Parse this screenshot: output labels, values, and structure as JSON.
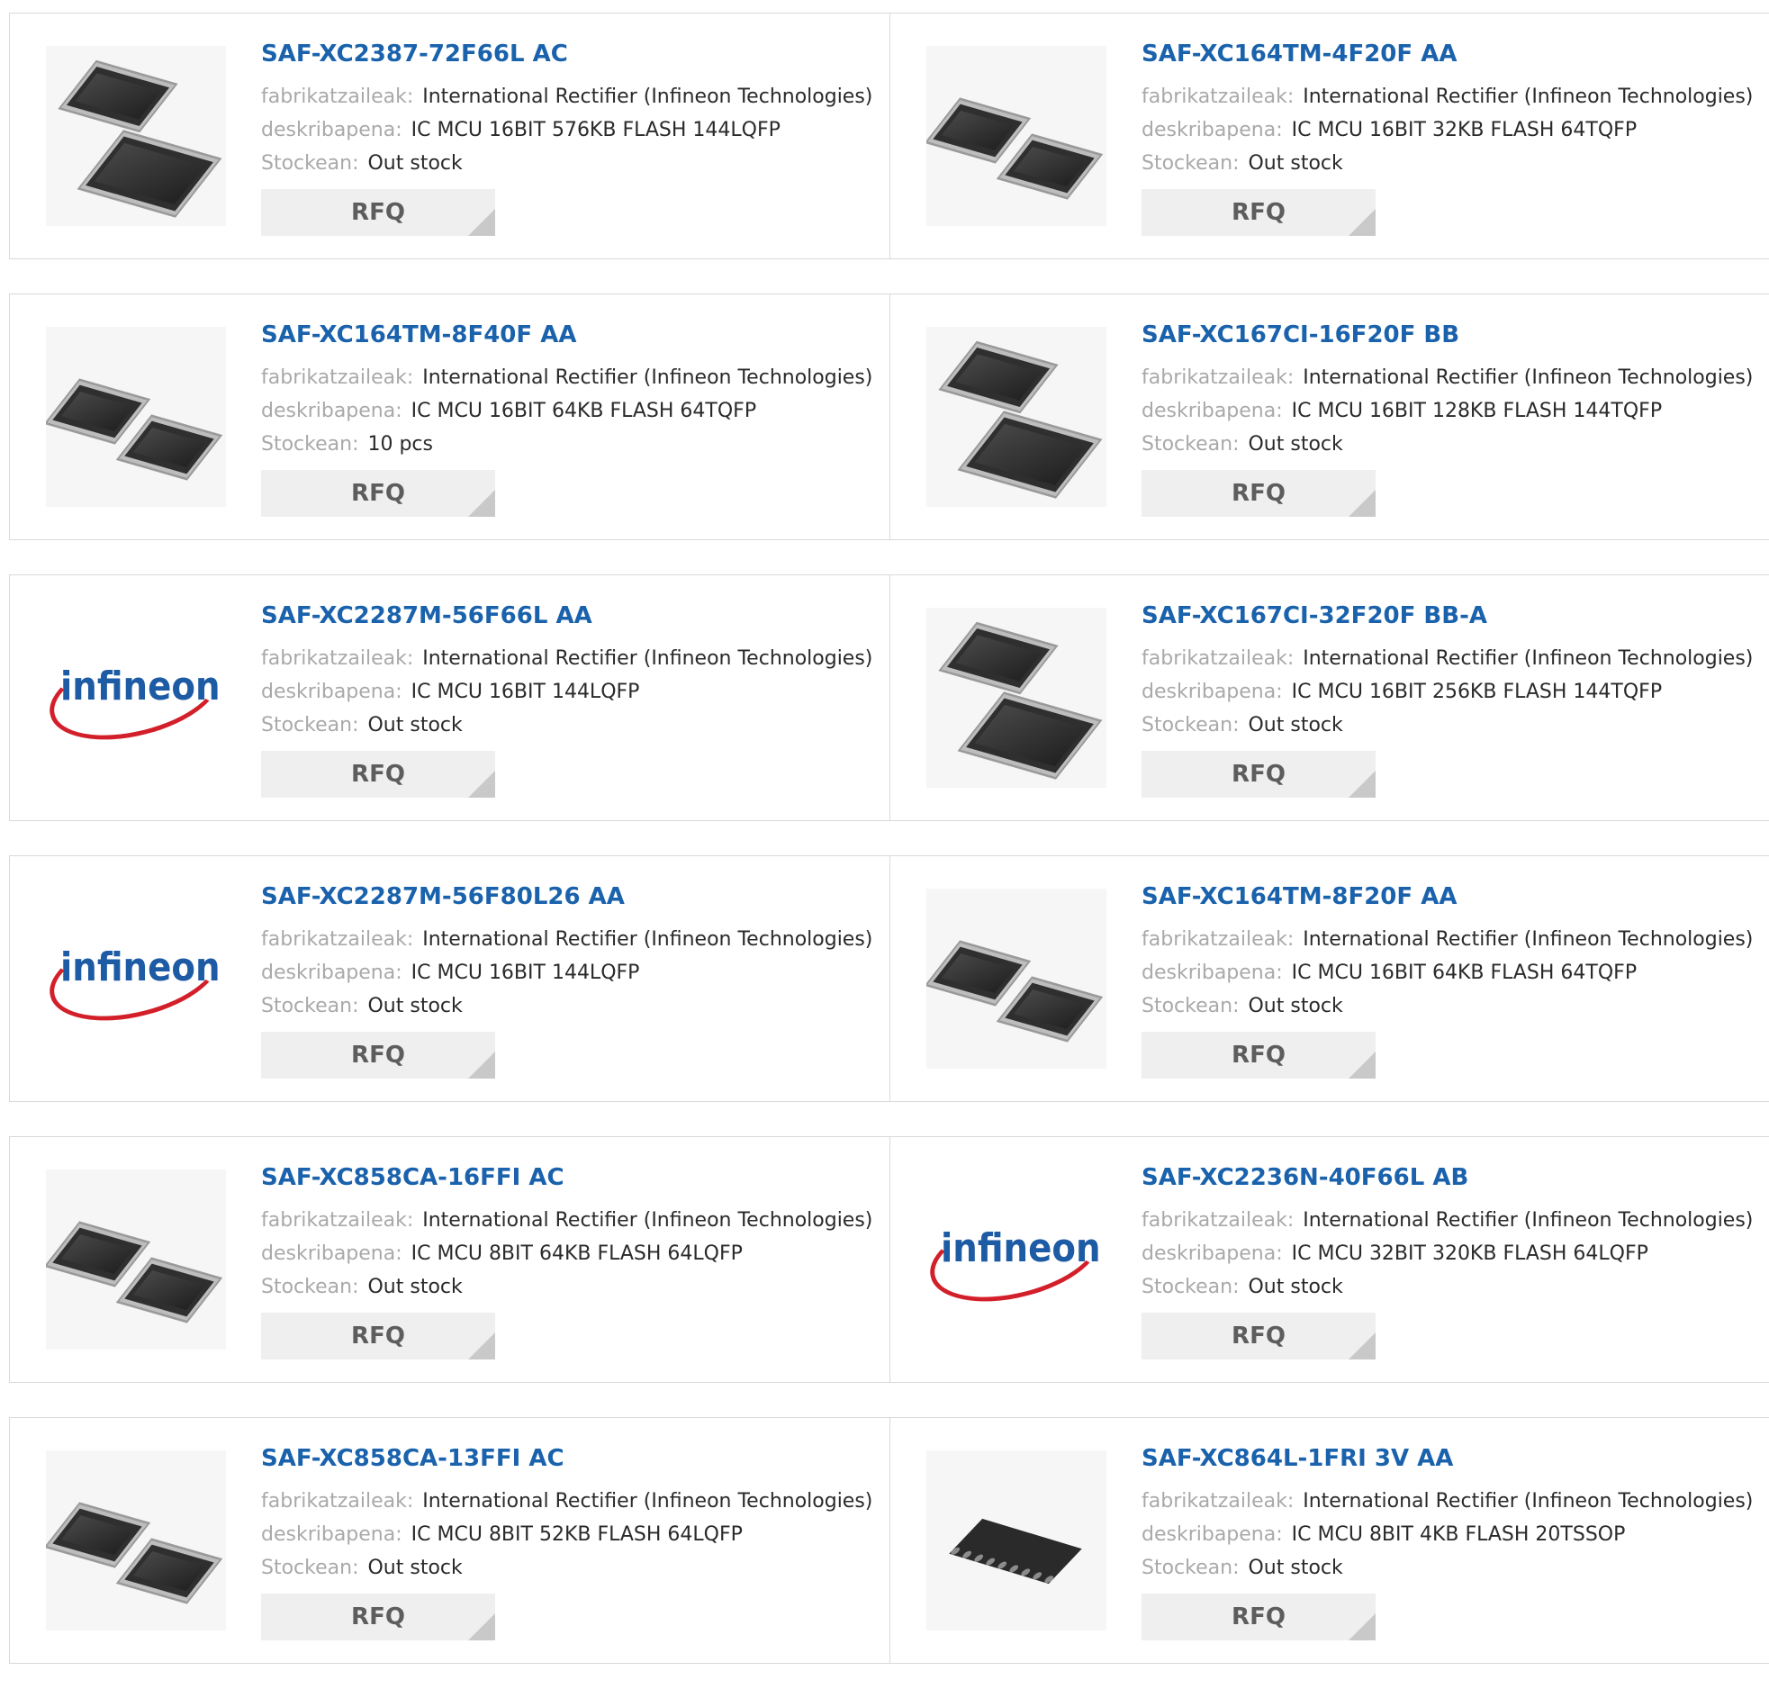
{
  "labels": {
    "manufacturer": "fabrikatzaileak:",
    "description": "deskribapena:",
    "stock": "Stockean:",
    "rfq": "RFQ"
  },
  "products": [
    {
      "part": "SAF-XC2387-72F66L AC",
      "manufacturer": "International Rectifier (Infineon Technologies)",
      "description": "IC MCU 16BIT 576KB FLASH 144LQFP",
      "stock": "Out stock",
      "image": "qfp-large-chips"
    },
    {
      "part": "SAF-XC164TM-4F20F AA",
      "manufacturer": "International Rectifier (Infineon Technologies)",
      "description": "IC MCU 16BIT 32KB FLASH 64TQFP",
      "stock": "Out stock",
      "image": "qfp-small-chips"
    },
    {
      "part": "SAF-XC164TM-8F40F AA",
      "manufacturer": "International Rectifier (Infineon Technologies)",
      "description": "IC MCU 16BIT 64KB FLASH 64TQFP",
      "stock": "10 pcs",
      "image": "qfp-small-chips"
    },
    {
      "part": "SAF-XC167CI-16F20F BB",
      "manufacturer": "International Rectifier (Infineon Technologies)",
      "description": "IC MCU 16BIT 128KB FLASH 144TQFP",
      "stock": "Out stock",
      "image": "qfp-large-chips"
    },
    {
      "part": "SAF-XC2287M-56F66L AA",
      "manufacturer": "International Rectifier (Infineon Technologies)",
      "description": "IC MCU 16BIT 144LQFP",
      "stock": "Out stock",
      "image": "infineon-logo",
      "logo_text": "infineon"
    },
    {
      "part": "SAF-XC167CI-32F20F BB-A",
      "manufacturer": "International Rectifier (Infineon Technologies)",
      "description": "IC MCU 16BIT 256KB FLASH 144TQFP",
      "stock": "Out stock",
      "image": "qfp-large-chips"
    },
    {
      "part": "SAF-XC2287M-56F80L26 AA",
      "manufacturer": "International Rectifier (Infineon Technologies)",
      "description": "IC MCU 16BIT 144LQFP",
      "stock": "Out stock",
      "image": "infineon-logo",
      "logo_text": "infineon"
    },
    {
      "part": "SAF-XC164TM-8F20F AA",
      "manufacturer": "International Rectifier (Infineon Technologies)",
      "description": "IC MCU 16BIT 64KB FLASH 64TQFP",
      "stock": "Out stock",
      "image": "qfp-small-chips"
    },
    {
      "part": "SAF-XC858CA-16FFI AC",
      "manufacturer": "International Rectifier (Infineon Technologies)",
      "description": "IC MCU 8BIT 64KB FLASH 64LQFP",
      "stock": "Out stock",
      "image": "qfp-small-chips"
    },
    {
      "part": "SAF-XC2236N-40F66L AB",
      "manufacturer": "International Rectifier (Infineon Technologies)",
      "description": "IC MCU 32BIT 320KB FLASH 64LQFP",
      "stock": "Out stock",
      "image": "infineon-logo",
      "logo_text": "infineon"
    },
    {
      "part": "SAF-XC858CA-13FFI AC",
      "manufacturer": "International Rectifier (Infineon Technologies)",
      "description": "IC MCU 8BIT 52KB FLASH 64LQFP",
      "stock": "Out stock",
      "image": "qfp-small-chips"
    },
    {
      "part": "SAF-XC864L-1FRI 3V AA",
      "manufacturer": "International Rectifier (Infineon Technologies)",
      "description": "IC MCU 8BIT 4KB FLASH 20TSSOP",
      "stock": "Out stock",
      "image": "tssop-chip"
    }
  ],
  "colors": {
    "title_link": "#1a62ac",
    "label": "#a9a9a9",
    "value": "#2a2a2a",
    "rfq_bg": "#efefef",
    "rfq_text": "#5d5d5d",
    "border": "#d9d9d9",
    "logo_red": "#d31f2a",
    "logo_blue": "#1d5ba4"
  }
}
